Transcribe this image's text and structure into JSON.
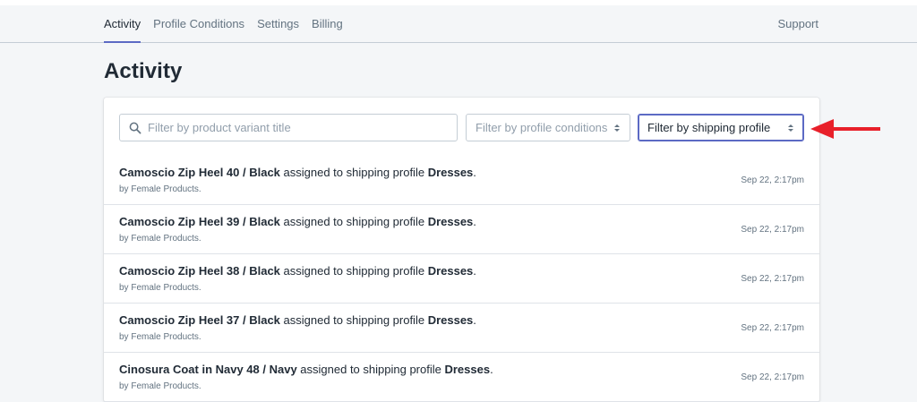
{
  "nav": {
    "tabs": [
      {
        "label": "Activity",
        "active": true
      },
      {
        "label": "Profile Conditions",
        "active": false
      },
      {
        "label": "Settings",
        "active": false
      },
      {
        "label": "Billing",
        "active": false
      }
    ],
    "support_label": "Support"
  },
  "page": {
    "title": "Activity"
  },
  "filters": {
    "search_placeholder": "Filter by product variant title",
    "conditions_label": "Filter by profile conditions",
    "shipping_label": "Filter by shipping profile"
  },
  "activity": [
    {
      "product": "Camoscio Zip Heel 40 / Black",
      "middle": " assigned to shipping profile ",
      "profile": "Dresses",
      "end": ".",
      "by": "by Female Products.",
      "time": "Sep 22, 2:17pm"
    },
    {
      "product": "Camoscio Zip Heel 39 / Black",
      "middle": " assigned to shipping profile ",
      "profile": "Dresses",
      "end": ".",
      "by": "by Female Products.",
      "time": "Sep 22, 2:17pm"
    },
    {
      "product": "Camoscio Zip Heel 38 / Black",
      "middle": " assigned to shipping profile ",
      "profile": "Dresses",
      "end": ".",
      "by": "by Female Products.",
      "time": "Sep 22, 2:17pm"
    },
    {
      "product": "Camoscio Zip Heel 37 / Black",
      "middle": " assigned to shipping profile ",
      "profile": "Dresses",
      "end": ".",
      "by": "by Female Products.",
      "time": "Sep 22, 2:17pm"
    },
    {
      "product": "Cinosura Coat in Navy 48 / Navy",
      "middle": " assigned to shipping profile ",
      "profile": "Dresses",
      "end": ".",
      "by": "by Female Products.",
      "time": "Sep 22, 2:17pm"
    }
  ],
  "colors": {
    "accent": "#5c6ac4",
    "annotation_arrow": "#e8202a",
    "background": "#f4f6f8"
  },
  "icons": {
    "search": "search-icon",
    "select_caret": "chevron-up-down-icon",
    "annotation": "red-arrow-icon"
  }
}
